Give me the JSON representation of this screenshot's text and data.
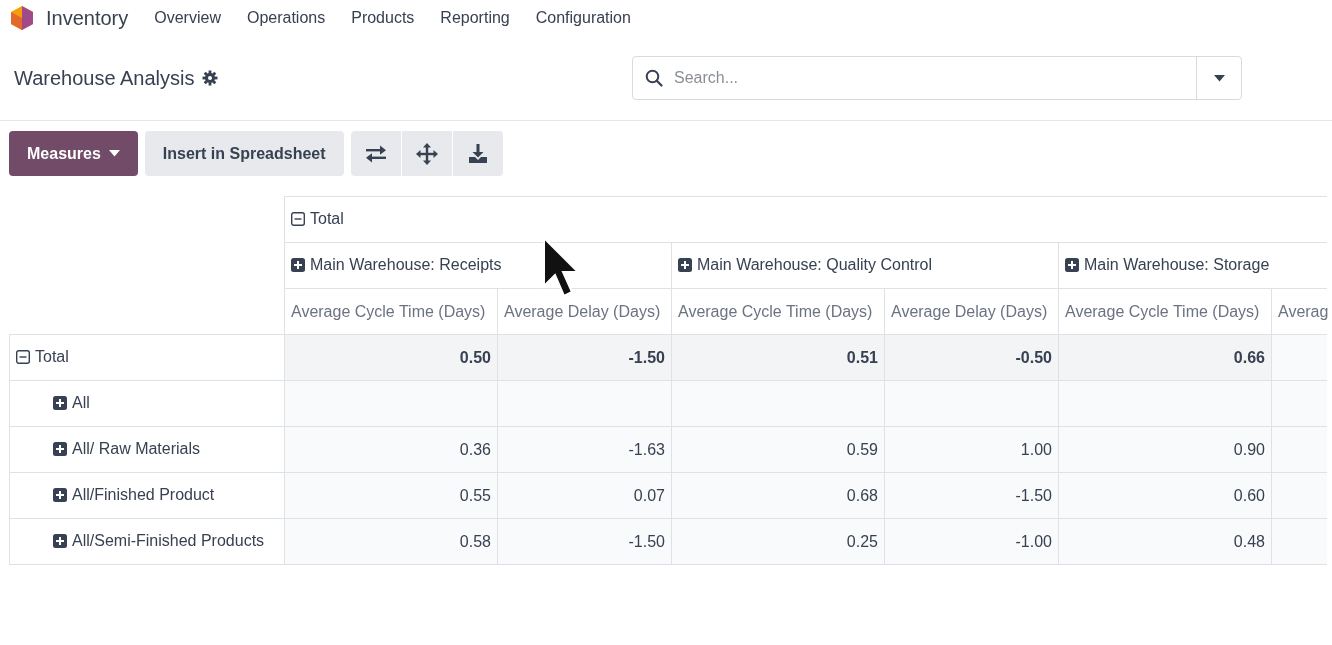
{
  "navbar": {
    "app_name": "Inventory",
    "menu": [
      "Overview",
      "Operations",
      "Products",
      "Reporting",
      "Configuration"
    ]
  },
  "control_panel": {
    "title": "Warehouse Analysis",
    "search": {
      "placeholder": "Search..."
    }
  },
  "toolbar": {
    "measures": "Measures",
    "insert": "Insert in Spreadsheet"
  },
  "pivot": {
    "column_header": {
      "label": "Total",
      "expanded": true,
      "children": [
        {
          "label": "Main Warehouse: Receipts",
          "expanded": false
        },
        {
          "label": "Main Warehouse: Quality Control",
          "expanded": false
        },
        {
          "label": "Main Warehouse: Storage",
          "expanded": false
        }
      ]
    },
    "measures": [
      "Average Cycle Time (Days)",
      "Average Delay (Days)",
      "Average Cycle Time (Days)",
      "Average Delay (Days)",
      "Average Cycle Time (Days)",
      "Averag"
    ],
    "rows": [
      {
        "label": "Total",
        "expanded": true,
        "values": [
          "0.50",
          "-1.50",
          "0.51",
          "-0.50",
          "0.66"
        ],
        "children": [
          {
            "label": "All",
            "expanded": false
          },
          {
            "label": "All/ Raw Materials",
            "expanded": false,
            "values": [
              "0.36",
              "-1.63",
              "0.59",
              "1.00",
              "0.90"
            ]
          },
          {
            "label": "All/Finished Product",
            "expanded": false,
            "values": [
              "0.55",
              "0.07",
              "0.68",
              "-1.50",
              "0.60"
            ]
          },
          {
            "label": "All/Semi-Finished Products",
            "expanded": false,
            "values": [
              "0.58",
              "-1.50",
              "0.25",
              "-1.00",
              "0.48"
            ]
          }
        ]
      }
    ]
  }
}
